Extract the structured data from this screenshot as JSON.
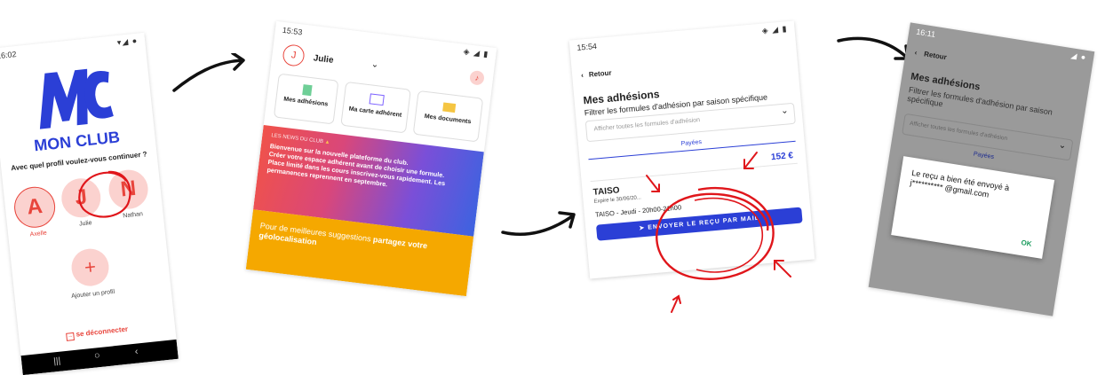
{
  "screen1": {
    "time": "16:02",
    "logo_text": "MC",
    "brand": "MON CLUB",
    "prompt": "Avec quel profil voulez-vous continuer ?",
    "profiles": [
      {
        "initial": "A",
        "name": "Axelle"
      },
      {
        "initial": "J",
        "name": "Julie"
      },
      {
        "initial": "N",
        "name": "Nathan"
      }
    ],
    "add_label": "Ajouter un profil",
    "add_symbol": "+",
    "logout": "se déconnecter"
  },
  "screen2": {
    "time": "15:53",
    "profile_initial": "J",
    "profile_name": "Julie",
    "tiles": [
      "Mes adhésions",
      "Ma carte adhérent",
      "Mes documents"
    ],
    "news_label": "LES NEWS DU CLUB",
    "news_lines": [
      "Bienvenue sur la nouvelle plateforme du club.",
      "Créer votre espace adhérent avant de choisir une formule.",
      "Place limité dans les cours inscrivez-vous rapidement. Les",
      "permanences reprennent en septembre."
    ],
    "geo_text": "Pour de meilleures suggestions",
    "geo_bold": "partagez votre géolocalisation"
  },
  "screen3": {
    "time": "15:54",
    "back": "Retour",
    "title": "Mes adhésions",
    "filter_label": "Filtrer les formules d'adhésion par saison spécifique",
    "select_placeholder": "Afficher toutes les formules d'adhésion",
    "tab": "Payées",
    "price": "152 €",
    "item_name": "TAISO",
    "expiry": "Expire le 30/06/20...",
    "schedule": "TAISO - Jeudi - 20h00-21h00",
    "send_button": "ENVOYER LE REÇU PAR MAIL"
  },
  "screen4": {
    "time": "16:11",
    "back": "Retour",
    "title": "Mes adhésions",
    "filter_label": "Filtrer les formules d'adhésion par saison spécifique",
    "select_placeholder": "Afficher toutes les formules d'adhésion",
    "tab": "Payées",
    "dialog_line1": "Le reçu a bien été envoyé à",
    "dialog_line2": "j********** @gmail.com",
    "ok": "OK"
  },
  "colors": {
    "brand_blue": "#2b3fd6",
    "accent_red": "#e8453c",
    "annotation_red": "#e0161b",
    "geo_orange": "#f5a800"
  }
}
